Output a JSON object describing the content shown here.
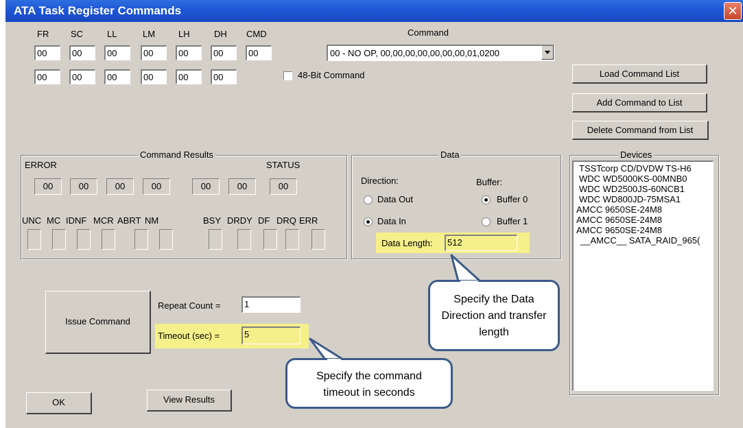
{
  "window": {
    "title": "ATA Task Register Commands",
    "close_glyph": "✕"
  },
  "registers": {
    "headers": [
      "FR",
      "SC",
      "LL",
      "LM",
      "LH",
      "DH",
      "CMD"
    ],
    "row1": [
      "00",
      "00",
      "00",
      "00",
      "00",
      "00",
      "00"
    ],
    "row2": [
      "00",
      "00",
      "00",
      "00",
      "00",
      "00"
    ]
  },
  "command": {
    "label": "Command",
    "selected": "00 - NO OP, 00,00,00,00,00,00,00,01,0200",
    "bit48_label": "48-Bit Command"
  },
  "buttons": {
    "load": "Load Command List",
    "add": "Add Command to List",
    "delete": "Delete Command from List",
    "issue": "Issue Command",
    "ok": "OK",
    "view": "View Results"
  },
  "results": {
    "title": "Command Results",
    "error_label": "ERROR",
    "status_label": "STATUS",
    "values": [
      "00",
      "00",
      "00",
      "00",
      "00",
      "00",
      "00"
    ],
    "error_bits": [
      "UNC",
      "MC",
      "IDNF",
      "MCR",
      "ABRT",
      "NM"
    ],
    "status_bits": [
      "BSY",
      "DRDY",
      "DF",
      "DRQ",
      "ERR"
    ]
  },
  "data": {
    "title": "Data",
    "direction_label": "Direction:",
    "buffer_label": "Buffer:",
    "data_out": "Data Out",
    "data_in": "Data In",
    "buffer0": "Buffer 0",
    "buffer1": "Buffer 1",
    "length_label": "Data Length:",
    "length_value": "512"
  },
  "devices": {
    "title": "Devices",
    "items": [
      "TSSTcorp CD/DVDW TS-H6",
      "WDC WD5000KS-00MNB0",
      "WDC WD2500JS-60NCB1",
      "WDC WD800JD-75MSA1",
      "AMCC 9650SE-24M8",
      "AMCC 9650SE-24M8",
      "AMCC 9650SE-24M8",
      "__AMCC__ SATA_RAID_965("
    ]
  },
  "repeat": {
    "label": "Repeat Count =",
    "value": "1"
  },
  "timeout": {
    "label": "Timeout (sec)  =",
    "value": "5"
  },
  "callouts": {
    "data": "Specify the Data Direction and transfer length",
    "timeout": "Specify the command timeout in seconds"
  },
  "colors": {
    "highlight": "#f5f08a",
    "titlebar": "#1f58d6",
    "callout_border": "#3c5a8a"
  }
}
